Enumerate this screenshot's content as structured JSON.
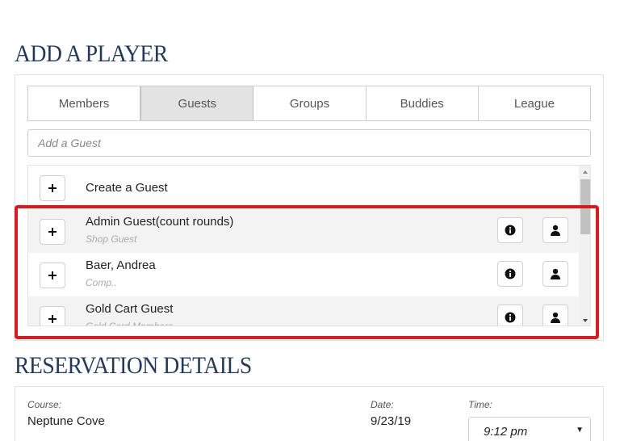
{
  "add_player": {
    "title": "ADD A PLAYER",
    "tabs": [
      {
        "label": "Members",
        "active": false
      },
      {
        "label": "Guests",
        "active": true
      },
      {
        "label": "Groups",
        "active": false
      },
      {
        "label": "Buddies",
        "active": false
      },
      {
        "label": "League",
        "active": false
      }
    ],
    "search": {
      "placeholder": "Add a Guest",
      "value": ""
    },
    "create_label": "Create a Guest",
    "guests": [
      {
        "name": "Admin Guest(count rounds)",
        "type": "Shop Guest"
      },
      {
        "name": "Baer, Andrea",
        "type": "Comp.."
      },
      {
        "name": "Gold Cart Guest",
        "type": "Gold Card Members"
      }
    ]
  },
  "reservation": {
    "title": "RESERVATION DETAILS",
    "course_label": "Course:",
    "course_value": "Neptune Cove",
    "date_label": "Date:",
    "date_value": "9/23/19",
    "time_label": "Time:",
    "time_value": "9:12 pm"
  },
  "colors": {
    "title": "#1f3a5f",
    "highlight": "#e0181b",
    "active_tab": "#e3e3e3"
  },
  "icons": [
    "plus-icon",
    "info-icon",
    "user-icon",
    "scroll-up-icon",
    "scroll-down-icon",
    "chevron-down-icon"
  ]
}
